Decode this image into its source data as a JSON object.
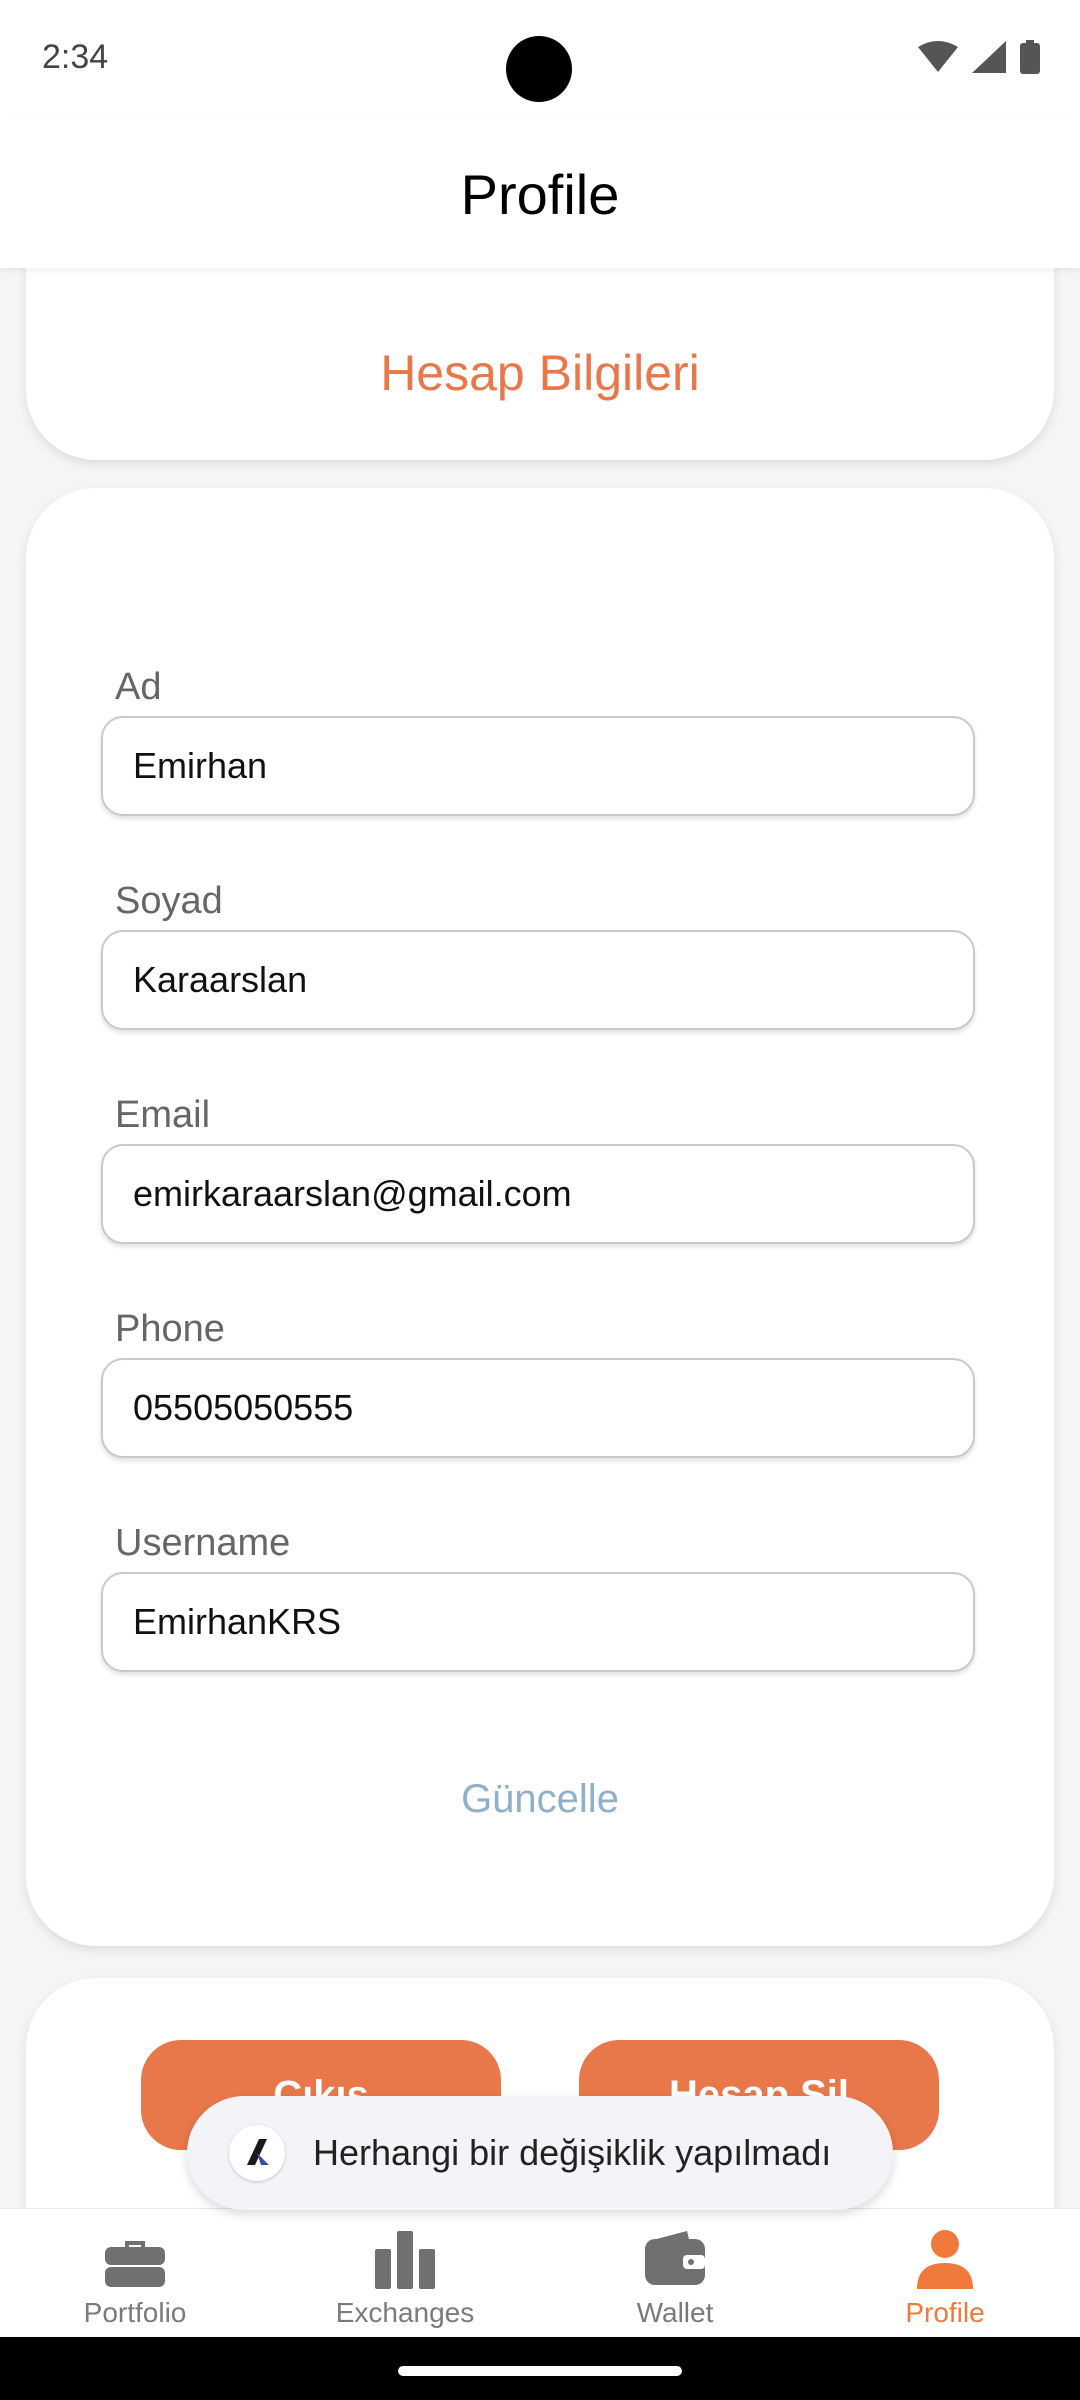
{
  "status_bar": {
    "time": "2:34"
  },
  "header": {
    "title": "Profile"
  },
  "account_card": {
    "title": "Hesap Bilgileri"
  },
  "form": {
    "fields": [
      {
        "label": "Ad",
        "value": "Emirhan"
      },
      {
        "label": "Soyad",
        "value": "Karaarslan"
      },
      {
        "label": "Email",
        "value": "emirkaraarslan@gmail.com"
      },
      {
        "label": "Phone",
        "value": "05505050555"
      },
      {
        "label": "Username",
        "value": "EmirhanKRS"
      }
    ],
    "update_label": "Güncelle"
  },
  "actions": {
    "logout_label": "Çıkış",
    "delete_label": "Hesap Sil"
  },
  "toast": {
    "message": "Herhangi bir değişiklik yapılmadı"
  },
  "bottom_nav": {
    "items": [
      {
        "label": "Portfolio",
        "icon": "briefcase-icon"
      },
      {
        "label": "Exchanges",
        "icon": "bar-chart-icon"
      },
      {
        "label": "Wallet",
        "icon": "wallet-icon"
      },
      {
        "label": "Profile",
        "icon": "person-icon",
        "active": true
      }
    ]
  },
  "colors": {
    "accent": "#e8784a",
    "nav_active": "#f0793c",
    "update_link": "#8fb0cb"
  }
}
